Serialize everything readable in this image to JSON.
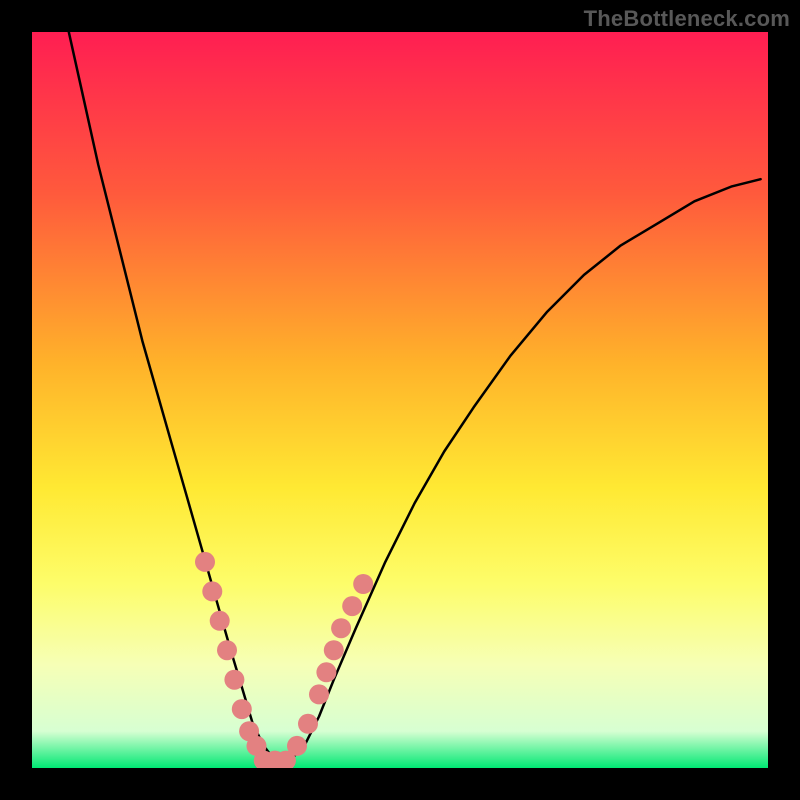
{
  "watermark": "TheBottleneck.com",
  "chart_data": {
    "type": "line",
    "title": "",
    "xlabel": "",
    "ylabel": "",
    "xlim": [
      0,
      100
    ],
    "ylim": [
      0,
      100
    ],
    "grid": false,
    "legend": false,
    "background_gradient_stops": [
      {
        "offset": 0.0,
        "color": "#ff1e52"
      },
      {
        "offset": 0.22,
        "color": "#ff5a3c"
      },
      {
        "offset": 0.45,
        "color": "#ffb22a"
      },
      {
        "offset": 0.62,
        "color": "#ffe933"
      },
      {
        "offset": 0.75,
        "color": "#fdfd6a"
      },
      {
        "offset": 0.86,
        "color": "#f6ffb6"
      },
      {
        "offset": 0.95,
        "color": "#d7ffd2"
      },
      {
        "offset": 1.0,
        "color": "#00e873"
      }
    ],
    "series": [
      {
        "name": "bottleneck-curve",
        "stroke": "#000000",
        "stroke_width": 2.5,
        "x": [
          5,
          7,
          9,
          11,
          13,
          15,
          17,
          19,
          21,
          23,
          25,
          27,
          28.5,
          30,
          31.5,
          33,
          35,
          37,
          39,
          41,
          44,
          48,
          52,
          56,
          60,
          65,
          70,
          75,
          80,
          85,
          90,
          95,
          99
        ],
        "values": [
          100,
          91,
          82,
          74,
          66,
          58,
          51,
          44,
          37,
          30,
          23,
          16,
          11,
          6,
          3,
          1,
          1,
          3,
          7,
          12,
          19,
          28,
          36,
          43,
          49,
          56,
          62,
          67,
          71,
          74,
          77,
          79,
          80
        ]
      },
      {
        "name": "highlight-dots",
        "type": "scatter",
        "fill": "#e38181",
        "radius": 10,
        "x": [
          23.5,
          24.5,
          25.5,
          26.5,
          27.5,
          28.5,
          29.5,
          30.5,
          31.5,
          33,
          34.5,
          36,
          37.5,
          39,
          40,
          41,
          42,
          43.5,
          45
        ],
        "values": [
          28,
          24,
          20,
          16,
          12,
          8,
          5,
          3,
          1,
          1,
          1,
          3,
          6,
          10,
          13,
          16,
          19,
          22,
          25
        ]
      }
    ]
  }
}
